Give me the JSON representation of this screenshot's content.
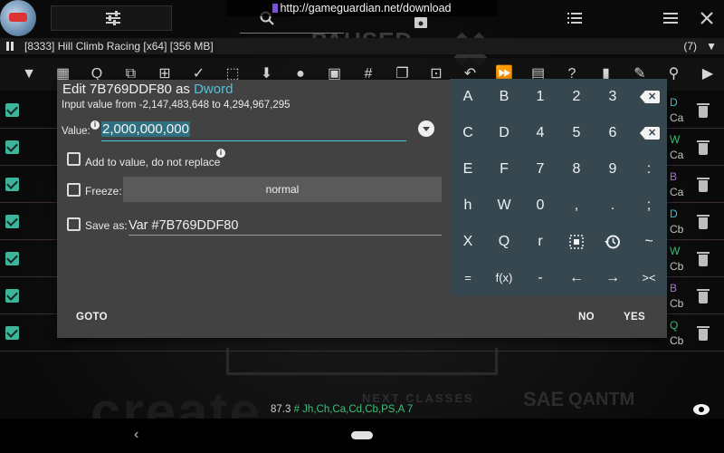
{
  "top": {
    "url": "http://gameguardian.net/download"
  },
  "process": {
    "name": "[8333] Hill Climb Racing [x64] [356 MB]",
    "count": "(7)"
  },
  "background": {
    "paused": "PAUSED",
    "next_classes": "NEXT CLASSES",
    "create": "create",
    "sae": "SAE",
    "qantm": "QANTM"
  },
  "toolbar_icons": [
    "filter-icon",
    "calculator-icon",
    "search-options-icon",
    "shuffle-icon",
    "add-box-icon",
    "check-icon",
    "selection-icon",
    "download-icon",
    "circle-icon",
    "chip-icon",
    "hash-search-icon",
    "copy-icon",
    "select-all-icon",
    "undo-icon",
    "fast-forward-icon",
    "save-icon",
    "help-search-icon",
    "delete-icon",
    "edit-icon",
    "search-icon",
    "play-icon"
  ],
  "rows": [
    {
      "t1": "D",
      "t2": "Ca",
      "c1": "#4fc3d9"
    },
    {
      "t1": "W",
      "t2": "Ca",
      "c1": "#3fbf7a"
    },
    {
      "t1": "B",
      "t2": "Ca",
      "c1": "#b07ad8"
    },
    {
      "t1": "D",
      "t2": "Cb",
      "c1": "#4fc3d9"
    },
    {
      "t1": "W",
      "t2": "Cb",
      "c1": "#3fbf7a"
    },
    {
      "t1": "B",
      "t2": "Cb",
      "c1": "#b07ad8"
    },
    {
      "t1": "Q",
      "t2": "Cb",
      "c1": "#3fbf7a"
    }
  ],
  "dialog": {
    "title_prefix": "Edit 7B769DDF80 as",
    "title_type": "Dword",
    "range": "Input value from -2,147,483,648 to 4,294,967,295",
    "value_label": "Value:",
    "value": "2,000,000,000",
    "add_label": "Add to value, do not replace",
    "freeze_label": "Freeze:",
    "freeze_value": "normal",
    "save_label": "Save as:",
    "save_value": "Var #7B769DDF80",
    "goto": "GOTO",
    "no": "NO",
    "yes": "YES"
  },
  "keypad": {
    "rows": [
      [
        "A",
        "B",
        "1",
        "2",
        "3",
        "backspace"
      ],
      [
        "C",
        "D",
        "4",
        "5",
        "6",
        "clear"
      ],
      [
        "E",
        "F",
        "7",
        "8",
        "9",
        ":"
      ],
      [
        "h",
        "W",
        "0",
        ",",
        ".",
        ";"
      ],
      [
        "X",
        "Q",
        "r",
        "select-icon",
        "history-icon",
        "~"
      ],
      [
        "=",
        "f(x)",
        "-",
        "←",
        "→",
        "><"
      ]
    ]
  },
  "bottom": {
    "value": "87.3",
    "regions": "# Jh,Ch,Ca,Cd,Cb,PS,A 7"
  }
}
